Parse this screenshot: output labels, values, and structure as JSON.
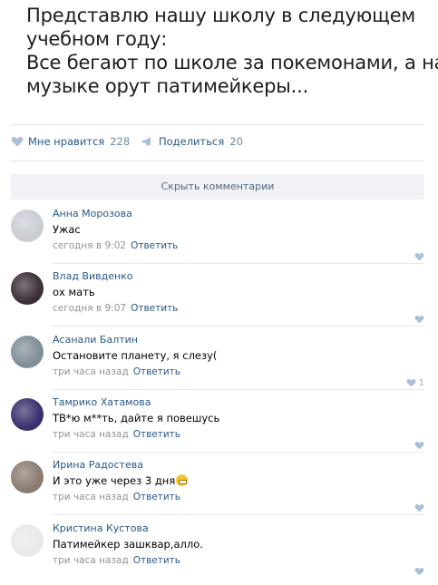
{
  "post": {
    "lines": [
      "Представлю нашу школу в следующем",
      "учебном году:",
      "Все бегают по школе за покемонами, а на",
      "музыке орут патимейкеры..."
    ]
  },
  "actions": {
    "like_label": "Мне нравится",
    "like_count": "228",
    "share_label": "Поделиться",
    "share_count": "20"
  },
  "hide_comments_label": "Скрыть комментарии",
  "reply_label": "Ответить",
  "comments": [
    {
      "author": "Анна Морозова",
      "text": "Ужас",
      "time": "сегодня в 9:02",
      "likes": "",
      "avatar_color": "#c9cdd4"
    },
    {
      "author": "Влад Вивденко",
      "text": "ох мать",
      "time": "сегодня в 9:07",
      "likes": "",
      "avatar_color": "#3b2e38"
    },
    {
      "author": "Асанали Балтин",
      "text": "Остановите планету, я слезу(",
      "time": "три часа назад",
      "likes": "1",
      "avatar_color": "#7f8f96"
    },
    {
      "author": "Тамрико Хатамова",
      "text": "ТВ*ю м**ть, дайте я повешусь",
      "time": "три часа назад",
      "likes": "",
      "avatar_color": "#3a2f6e"
    },
    {
      "author": "Ирина Радостева",
      "text": "И это уже через 3 дня",
      "time": "три часа назад",
      "likes": "",
      "avatar_color": "#8a7b70"
    },
    {
      "author": "Кристина Кустова",
      "text": "Патимейкер зашквар,алло.",
      "time": "три часа назад",
      "likes": "",
      "avatar_color": "#e9e9e9"
    }
  ],
  "colors": {
    "link": "#2a5885",
    "muted": "#939393",
    "separator": "#e7e8ec",
    "hide_bar_bg": "#f0f2f5",
    "like_icon": "#aac0d8"
  }
}
